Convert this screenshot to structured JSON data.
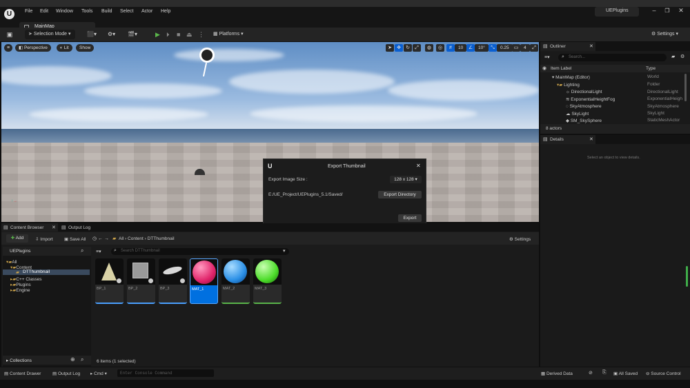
{
  "window": {
    "app_title": "UEPlugins",
    "level_tab": "MainMap"
  },
  "menu": [
    "File",
    "Edit",
    "Window",
    "Tools",
    "Build",
    "Select",
    "Actor",
    "Help"
  ],
  "toolbar": {
    "selection_mode": "Selection Mode",
    "platforms": "Platforms",
    "settings": "Settings"
  },
  "viewport": {
    "perspective": "Perspective",
    "lit": "Lit",
    "show": "Show",
    "grid_snap": "10",
    "rotation_snap": "10°",
    "scale_snap": "0.25",
    "camera_speed": "4"
  },
  "dialog": {
    "title": "Export Thumbnail",
    "image_size_label": "Export Image Size :",
    "image_size_value": "128 x 128",
    "path": "E:/UE_Project/UEPlugins_5.1/Saved/",
    "export_dir_button": "Export Directory",
    "export_button": "Export"
  },
  "outliner": {
    "tab": "Outliner",
    "search_placeholder": "Search...",
    "col_label": "Item Label",
    "col_type": "Type",
    "rows": [
      {
        "label": "MainMap (Editor)",
        "type": "World"
      },
      {
        "label": "Lighting",
        "type": "Folder"
      },
      {
        "label": "DirectionalLight",
        "type": "DirectionalLight"
      },
      {
        "label": "ExponentialHeightFog",
        "type": "ExponentialHeigh"
      },
      {
        "label": "SkyAtmosphere",
        "type": "SkyAtmosphere"
      },
      {
        "label": "SkyLight",
        "type": "SkyLight"
      },
      {
        "label": "SM_SkySphere",
        "type": "StaticMeshActor"
      }
    ],
    "count": "8 actors"
  },
  "details": {
    "tab": "Details",
    "empty": "Select an object to view details."
  },
  "content_browser": {
    "tab": "Content Browser",
    "output_tab": "Output Log",
    "add": "Add",
    "import": "Import",
    "save_all": "Save All",
    "crumbs": [
      "All",
      "Content",
      "DTThumbnail"
    ],
    "settings": "Settings",
    "search_placeholder": "Search DTThumbnail",
    "source_root": "UEPlugins",
    "tree": [
      "All",
      "Content",
      "DTThumbnail",
      "C++ Classes",
      "Plugins",
      "Engine"
    ],
    "collections": "Collections",
    "assets": [
      "BP_1",
      "BP_2",
      "BP_3",
      "MAT_1",
      "MAT_2",
      "MAT_3"
    ],
    "item_count": "6 items (1 selected)"
  },
  "statusbar": {
    "content_drawer": "Content Drawer",
    "output_log": "Output Log",
    "cmd": "Cmd",
    "console_placeholder": "Enter Console Command",
    "derived_data": "Derived Data",
    "all_saved": "All Saved",
    "source_control": "Source Control"
  },
  "colors": {
    "accent": "#0070e0",
    "play": "#5ab54a",
    "selection": "#0a5fd1"
  }
}
